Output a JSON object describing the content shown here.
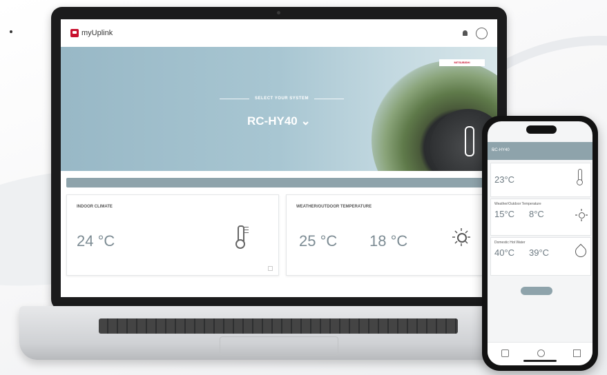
{
  "laptop": {
    "app": {
      "logo_text": "myUplink"
    },
    "nav": {
      "menu": [
        "",
        "",
        ""
      ],
      "lang": ""
    },
    "hero": {
      "label": "SELECT YOUR SYSTEM",
      "system": "RC-HY40",
      "brand_badge": "MITSUBISHI"
    },
    "bar": {
      "left": "",
      "right": ""
    },
    "indoor_card": {
      "title": "INDOOR CLIMATE",
      "value": "24 °C",
      "caption": ""
    },
    "outdoor_card": {
      "title": "WEATHER/OUTDOOR TEMPERATURE",
      "value1": "25 °C",
      "caption1": "",
      "value2": "18 °C",
      "caption2": ""
    }
  },
  "phone": {
    "status": {
      "time": "",
      "signal": ""
    },
    "header": {
      "system": "RC-HY40"
    },
    "cards": {
      "indoor": {
        "title": "",
        "value": "23°C"
      },
      "outdoor": {
        "title": "Weather/Outdoor Temperature",
        "value1": "15°C",
        "value2": "8°C"
      },
      "water": {
        "title": "Domestic Hot Water",
        "value1": "40°C",
        "value2": "39°C"
      }
    },
    "add_button": ""
  },
  "icons": [
    "thermometer-icon",
    "sun-icon",
    "water-drop-icon",
    "bell-icon",
    "user-icon"
  ],
  "colors": {
    "accent": "#8ea3ab",
    "brand": "#c8102e",
    "hero": "#a8c6d2"
  }
}
